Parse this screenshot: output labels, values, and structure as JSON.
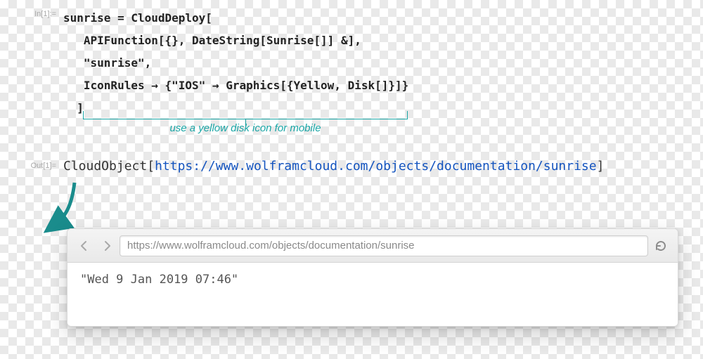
{
  "in_label": "In[1]:=",
  "out_label": "Out[1]=",
  "code": {
    "l1": "sunrise = CloudDeploy[",
    "l2": "   APIFunction[{}, DateString[Sunrise[]] &],",
    "l3": "   \"sunrise\",",
    "l4": "   IconRules → {\"IOS\" → Graphics[{Yellow, Disk[]}]}",
    "l5": "  ]"
  },
  "annotation": "use a yellow disk icon for mobile",
  "output": {
    "head": "CloudObject",
    "open": "[",
    "url": "https://www.wolframcloud.com/objects/documentation/sunrise",
    "close": "]"
  },
  "browser": {
    "address": "https://www.wolframcloud.com/objects/documentation/sunrise",
    "page_text": "\"Wed 9 Jan 2019 07:46\""
  }
}
